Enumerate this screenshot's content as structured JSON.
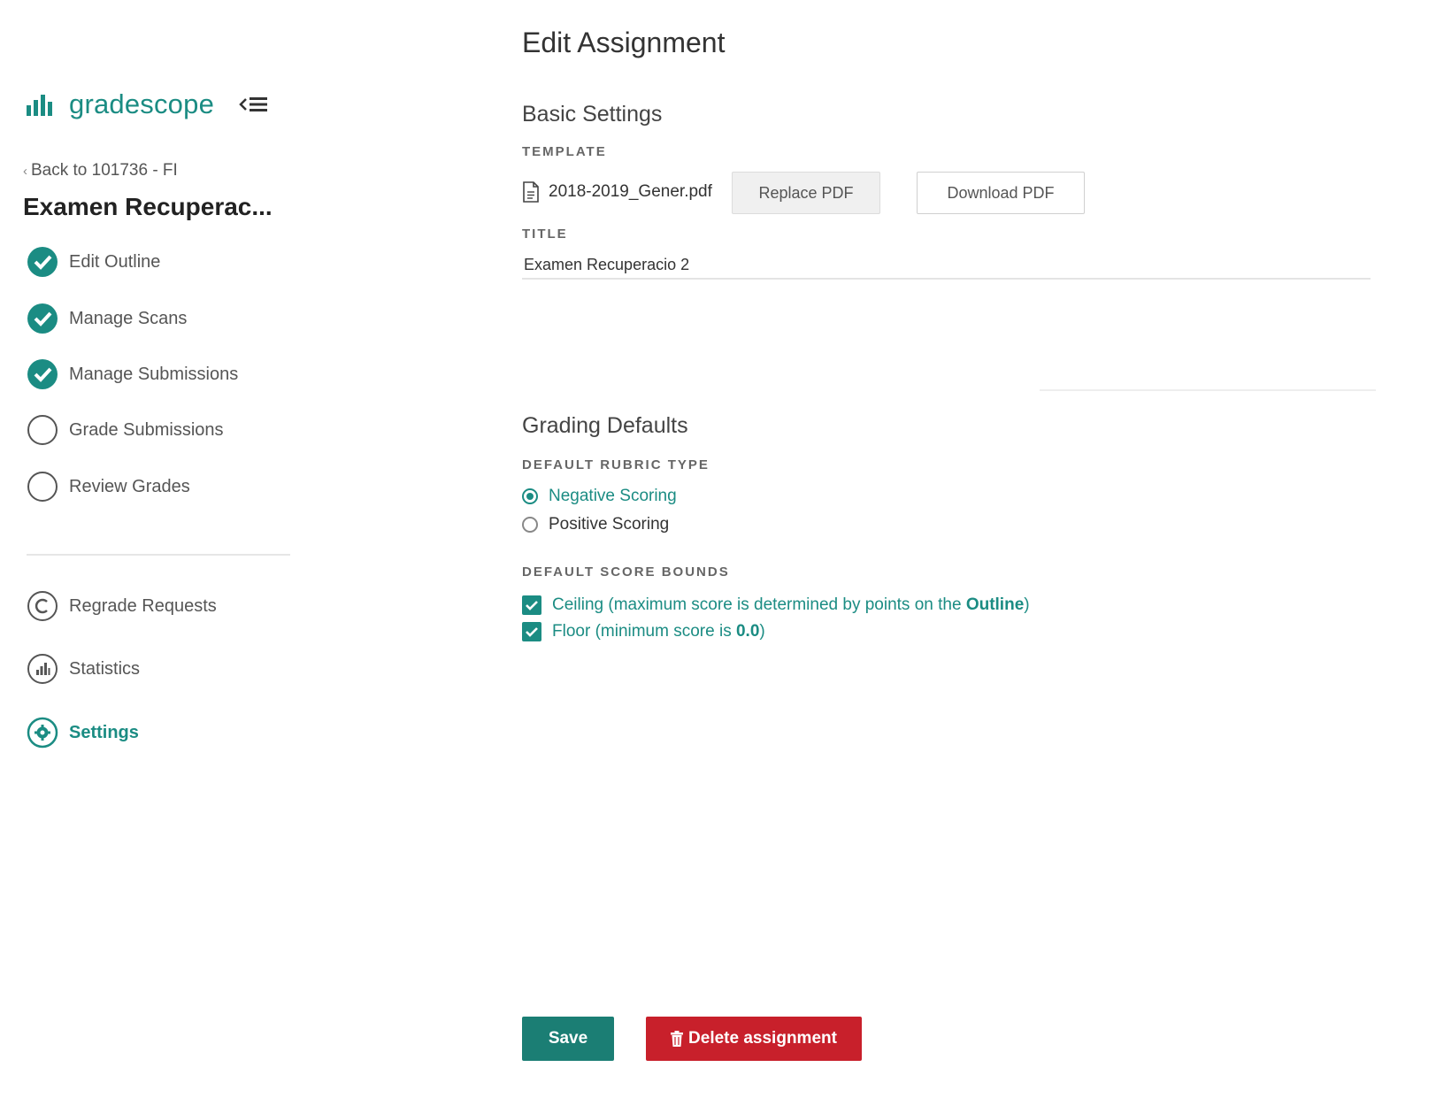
{
  "brand": {
    "name": "gradescope",
    "accent": "#1b8c83"
  },
  "sidebar": {
    "back_link": "Back to 101736 - FI",
    "course_title": "Examen Recuperac...",
    "workflow": [
      {
        "label": "Edit Outline",
        "state": "done",
        "icon": "check-circle-icon"
      },
      {
        "label": "Manage Scans",
        "state": "done",
        "icon": "check-circle-icon"
      },
      {
        "label": "Manage Submissions",
        "state": "done",
        "icon": "check-circle-icon"
      },
      {
        "label": "Grade Submissions",
        "state": "todo",
        "icon": "empty-circle-icon"
      },
      {
        "label": "Review Grades",
        "state": "todo",
        "icon": "empty-circle-icon"
      }
    ],
    "tools": [
      {
        "label": "Regrade Requests",
        "icon": "regrade-icon"
      },
      {
        "label": "Statistics",
        "icon": "statistics-icon"
      },
      {
        "label": "Settings",
        "icon": "settings-gear-icon",
        "active": true
      }
    ]
  },
  "main": {
    "page_title": "Edit Assignment",
    "basic_settings": {
      "heading": "Basic Settings",
      "template_label": "TEMPLATE",
      "file_name": "2018-2019_Gener.pdf",
      "replace_button": "Replace PDF",
      "download_button": "Download PDF",
      "title_label": "TITLE",
      "title_value": "Examen Recuperacio 2"
    },
    "grading_defaults": {
      "heading": "Grading Defaults",
      "rubric_label": "DEFAULT RUBRIC TYPE",
      "rubric_options": [
        {
          "label": "Negative Scoring",
          "selected": true
        },
        {
          "label": "Positive Scoring",
          "selected": false
        }
      ],
      "bounds_label": "DEFAULT SCORE BOUNDS",
      "ceiling_prefix": "Ceiling (maximum score is determined by points on the ",
      "ceiling_bold": "Outline",
      "ceiling_suffix": ")",
      "floor_prefix": "Floor (minimum score is ",
      "floor_bold": "0.0",
      "floor_suffix": ")"
    },
    "actions": {
      "save": "Save",
      "delete": "Delete assignment",
      "save_color": "#1b7e74",
      "delete_color": "#c8202b"
    }
  }
}
